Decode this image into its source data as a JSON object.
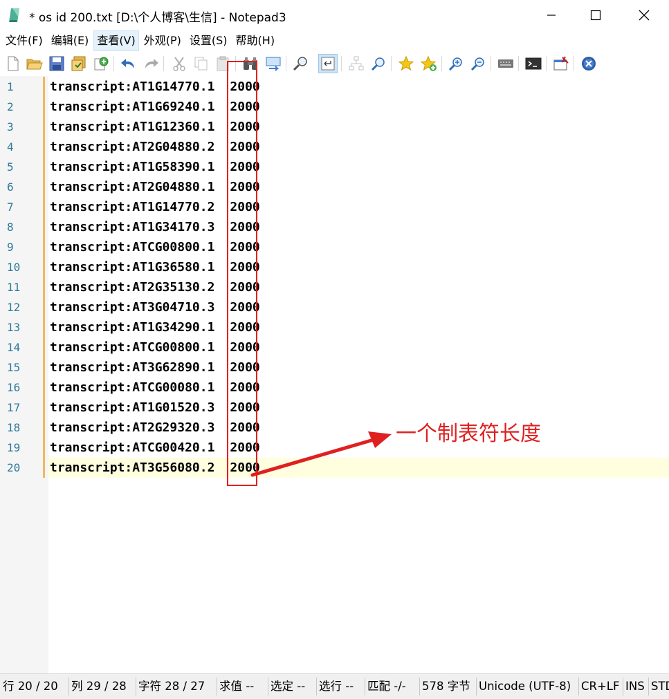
{
  "window": {
    "title": "* os id 200.txt [D:\\个人博客\\生信] - Notepad3",
    "controls": {
      "minimize": "—",
      "maximize": "☐",
      "close": "✕"
    }
  },
  "menu": {
    "items": [
      "文件(F)",
      "编辑(E)",
      "查看(V)",
      "外观(P)",
      "设置(S)",
      "帮助(H)"
    ],
    "active_index": 2
  },
  "toolbar": {
    "icons": [
      "new-file-icon",
      "open-folder-icon",
      "save-icon",
      "save-as-icon",
      "save-copy-icon",
      "undo-icon",
      "redo-icon",
      "cut-icon",
      "copy-icon",
      "paste-icon",
      "find-icon",
      "replace-icon",
      "find-in-files-icon",
      "word-wrap-icon",
      "schema-icon",
      "find-zoom-icon",
      "favorite-star-icon",
      "add-favorite-icon",
      "zoom-in-icon",
      "zoom-out-icon",
      "keyboard-icon",
      "terminal-icon",
      "pin-icon",
      "close-file-icon"
    ]
  },
  "editor": {
    "lines": [
      {
        "num": "1",
        "id": "transcript:AT1G14770.1",
        "val": "2000"
      },
      {
        "num": "2",
        "id": "transcript:AT1G69240.1",
        "val": "2000"
      },
      {
        "num": "3",
        "id": "transcript:AT1G12360.1",
        "val": "2000"
      },
      {
        "num": "4",
        "id": "transcript:AT2G04880.2",
        "val": "2000"
      },
      {
        "num": "5",
        "id": "transcript:AT1G58390.1",
        "val": "2000"
      },
      {
        "num": "6",
        "id": "transcript:AT2G04880.1",
        "val": "2000"
      },
      {
        "num": "7",
        "id": "transcript:AT1G14770.2",
        "val": "2000"
      },
      {
        "num": "8",
        "id": "transcript:AT1G34170.3",
        "val": "2000"
      },
      {
        "num": "9",
        "id": "transcript:ATCG00800.1",
        "val": "2000"
      },
      {
        "num": "10",
        "id": "transcript:AT1G36580.1",
        "val": "2000"
      },
      {
        "num": "11",
        "id": "transcript:AT2G35130.2",
        "val": "2000"
      },
      {
        "num": "12",
        "id": "transcript:AT3G04710.3",
        "val": "2000"
      },
      {
        "num": "13",
        "id": "transcript:AT1G34290.1",
        "val": "2000"
      },
      {
        "num": "14",
        "id": "transcript:ATCG00800.1",
        "val": "2000"
      },
      {
        "num": "15",
        "id": "transcript:AT3G62890.1",
        "val": "2000"
      },
      {
        "num": "16",
        "id": "transcript:ATCG00080.1",
        "val": "2000"
      },
      {
        "num": "17",
        "id": "transcript:AT1G01520.3",
        "val": "2000"
      },
      {
        "num": "18",
        "id": "transcript:AT2G29320.3",
        "val": "2000"
      },
      {
        "num": "19",
        "id": "transcript:ATCG00420.1",
        "val": "2000"
      },
      {
        "num": "20",
        "id": "transcript:AT3G56080.2",
        "val": "2000"
      }
    ],
    "current_line": 20
  },
  "annotation": {
    "label": "一个制表符长度",
    "color": "#e02020"
  },
  "statusbar": {
    "fields": [
      "行  20 / 20",
      "列  29 / 28",
      "字符  28 / 27",
      "求值  --",
      "选定  --",
      "选行  --",
      "匹配  -/-",
      "578 字节",
      "Unicode (UTF-8)",
      "CR+LF",
      "INS",
      "STD"
    ]
  },
  "colors": {
    "line_number": "#2b7a99",
    "gutter_bg": "#f5f5f5",
    "current_line_bg": "#ffffe0",
    "annotation": "#e02020"
  }
}
